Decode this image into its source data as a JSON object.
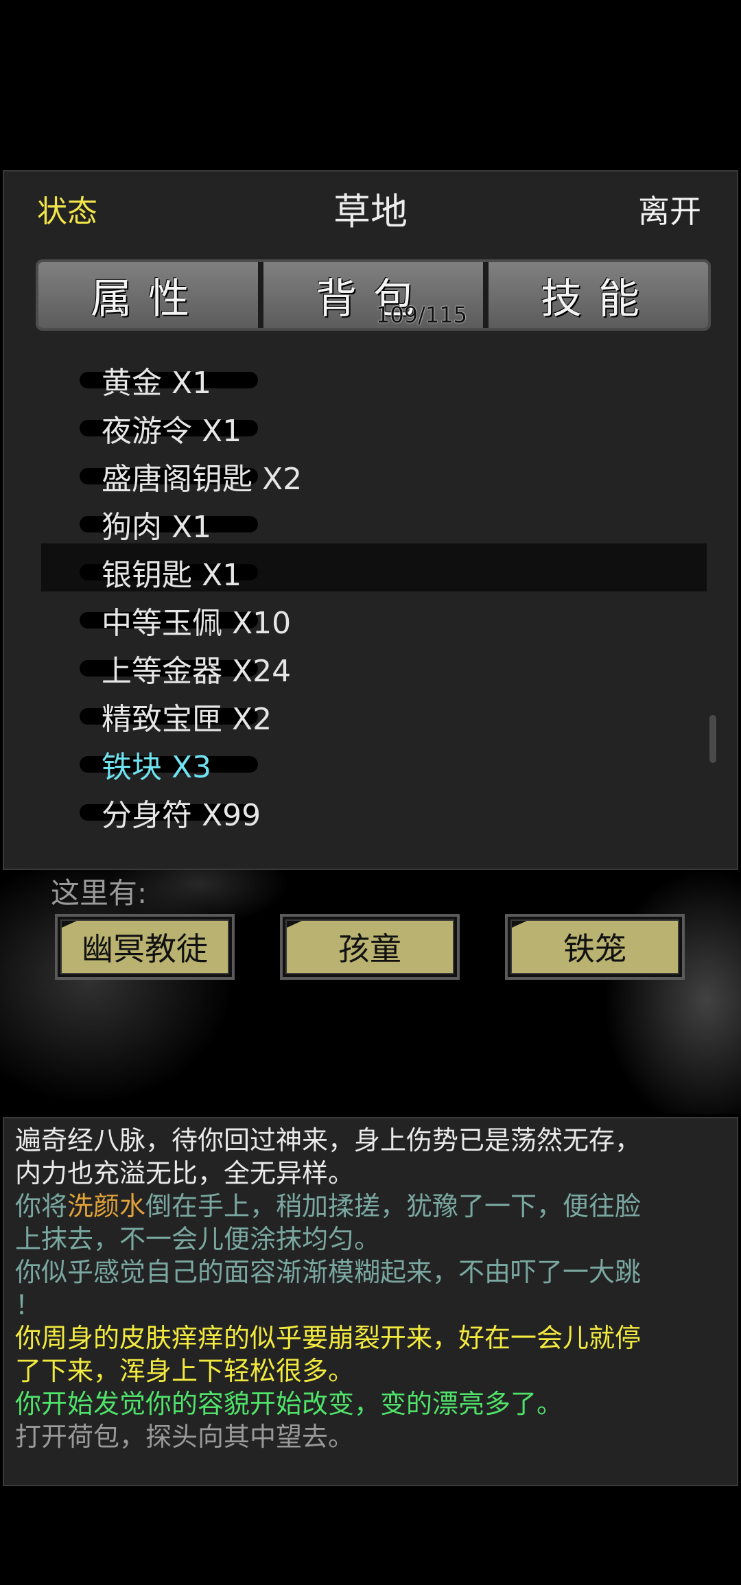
{
  "header": {
    "status_label": "状态",
    "location": "草地",
    "leave_label": "离开"
  },
  "tabs": [
    {
      "label": "属性"
    },
    {
      "label": "背包",
      "count": "109/115"
    },
    {
      "label": "技能"
    }
  ],
  "inventory": [
    "黄金 X1",
    "夜游令 X1",
    "盛唐阁钥匙 X2",
    "狗肉 X1",
    "银钥匙 X1",
    "中等玉佩 X10",
    "上等金器 X24",
    "精致宝匣 X2",
    "铁块 X3",
    "分身符 X99"
  ],
  "selected_item": "银钥匙 X1",
  "highlighted_item": "铁块 X3",
  "here": {
    "label": "这里有:",
    "entities": [
      "幽冥教徒",
      "孩童",
      "铁笼"
    ]
  },
  "log": {
    "line1": "遍奇经八脉，待你回过神来，身上伤势已是荡然无存，",
    "line2": "内力也充溢无比，全无异样。",
    "line3_pre": "你将",
    "line3_item": "洗颜水",
    "line3_post": "倒在手上，稍加揉搓，犹豫了一下，便往脸",
    "line4": "上抹去，不一会儿便涂抹均匀。",
    "line5": "你似乎感觉自己的面容渐渐模糊起来，不由吓了一大跳",
    "line6": "！",
    "line7": "你周身的皮肤痒痒的似乎要崩裂开来，好在一会儿就停",
    "line8": "了下来，浑身上下轻松很多。",
    "line9": "你开始发觉你的容貌开始改变，变的漂亮多了。",
    "line10": "打开荷包，探头向其中望去。"
  },
  "colors": {
    "status": "#f2e54a",
    "highlight": "#6fe3f0",
    "npc_button": "#b9b270"
  }
}
